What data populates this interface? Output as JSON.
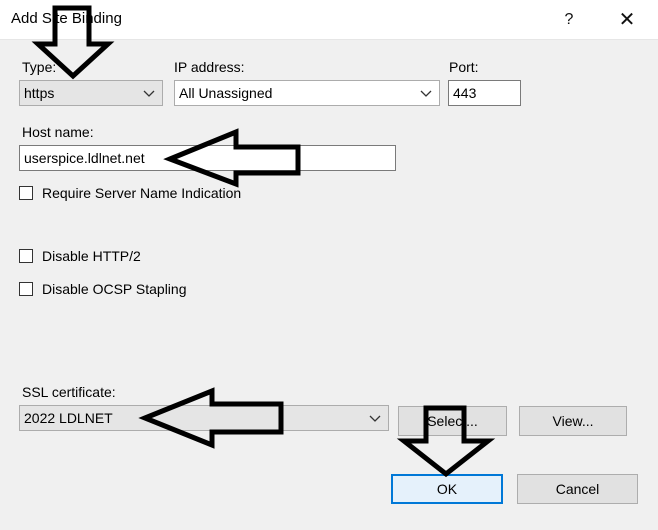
{
  "window": {
    "title": "Add Site Binding",
    "help_glyph": "?",
    "close_glyph": "✕"
  },
  "type": {
    "label": "Type:",
    "value": "https"
  },
  "ip": {
    "label": "IP address:",
    "value": "All Unassigned"
  },
  "port": {
    "label": "Port:",
    "value": "443"
  },
  "host": {
    "label": "Host name:",
    "value": "userspice.ldlnet.net"
  },
  "sni": {
    "label": "Require Server Name Indication",
    "checked": false
  },
  "http2": {
    "label": "Disable HTTP/2",
    "checked": false
  },
  "ocsp": {
    "label": "Disable OCSP Stapling",
    "checked": false
  },
  "ssl": {
    "label": "SSL certificate:",
    "value": "2022 LDLNET"
  },
  "buttons": {
    "select": "Select...",
    "view": "View...",
    "ok": "OK",
    "cancel": "Cancel"
  },
  "colors": {
    "annotation_arrow": "#000000",
    "default_button_border": "#0078d7"
  }
}
